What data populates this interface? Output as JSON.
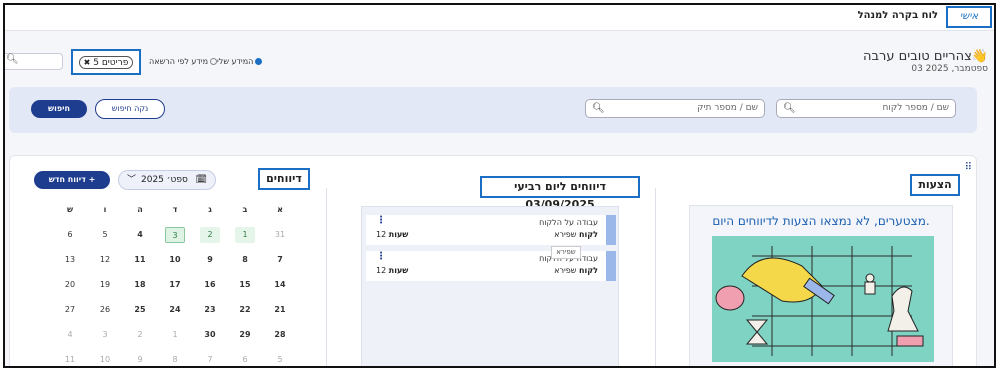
{
  "topbar": {
    "tab_personal": "אישי",
    "tab_board": "לוח בקרה למנהל"
  },
  "header": {
    "greeting": "צהריים טובים ערבה👋",
    "date": "03 ספטמבר, 2025"
  },
  "filters": {
    "radio_my_info": "המידע שלי",
    "radio_by_permission": "מידע לפי הרשאה",
    "chip_label": "5 פריטים",
    "search_customer_placeholder": "שם / מספר לקוח",
    "search_case_placeholder": "שם / מספר תיק",
    "clear_search": "נקה חיפוש",
    "search_button": "חיפוש"
  },
  "suggestions": {
    "title": "הצעות",
    "message": "מצטערים, לא נמצאו הצעות לדיווחים היום."
  },
  "daily_reports": {
    "title": "דיווחים ליום רביעי 03/09/2025",
    "items": [
      {
        "task": "עבודה על הלקוח",
        "client_label": "לקוח",
        "client": "שפירא",
        "hours_label": "שעות",
        "hours": "12"
      },
      {
        "task": "עבודה על הלקוח",
        "client_label": "לקוח",
        "client": "שפירא",
        "hours_label": "שעות",
        "hours": "12"
      }
    ],
    "tooltip": "שפירא"
  },
  "reports": {
    "title": "דיווחים",
    "month": "ספט׳ 2025",
    "new_report": "דיווח חדש +",
    "weekdays": [
      "א",
      "ב",
      "ג",
      "ד",
      "ה",
      "ו",
      "ש"
    ],
    "weeks": [
      [
        "31",
        "1",
        "2",
        "3",
        "4",
        "5",
        "6"
      ],
      [
        "7",
        "8",
        "9",
        "10",
        "11",
        "12",
        "13"
      ],
      [
        "14",
        "15",
        "16",
        "17",
        "18",
        "19",
        "20"
      ],
      [
        "21",
        "22",
        "23",
        "24",
        "25",
        "26",
        "27"
      ],
      [
        "28",
        "29",
        "30",
        "1",
        "2",
        "3",
        "4"
      ],
      [
        "5",
        "6",
        "7",
        "8",
        "9",
        "10",
        "11"
      ]
    ]
  },
  "colors": {
    "primary": "#1f3d8f",
    "accent": "#1a6fc4",
    "highlight": "#dff3e4"
  }
}
